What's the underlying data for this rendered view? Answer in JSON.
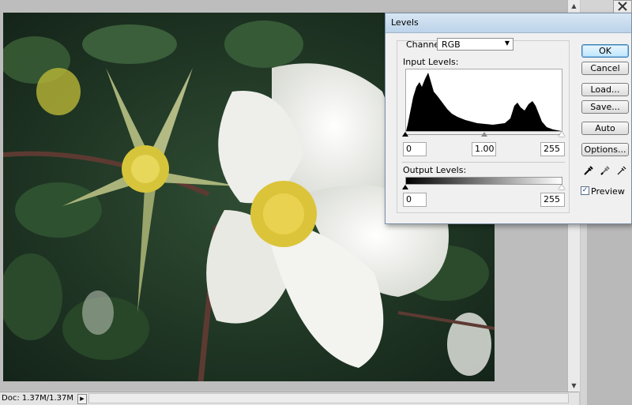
{
  "dialog": {
    "title": "Levels",
    "channel_label": "Channel:",
    "channel_value": "RGB",
    "input_levels_label": "Input Levels:",
    "input_black": "0",
    "input_gamma": "1.00",
    "input_white": "255",
    "output_levels_label": "Output Levels:",
    "output_black": "0",
    "output_white": "255",
    "buttons": {
      "ok": "OK",
      "cancel": "Cancel",
      "load": "Load...",
      "save": "Save...",
      "auto": "Auto",
      "options": "Options..."
    },
    "preview_label": "Preview",
    "preview_checked": true
  },
  "status": {
    "doc_info": "Doc: 1.37M/1.37M"
  },
  "icons": {
    "black_eyedropper": "black-eyedropper-icon",
    "gray_eyedropper": "gray-eyedropper-icon",
    "white_eyedropper": "white-eyedropper-icon",
    "scroll_up": "▲",
    "scroll_down": "▼",
    "play": "▶",
    "check": "✓",
    "tool": "tools-icon"
  },
  "colors": {
    "accent": "#3c7fb1",
    "title_bar": "#bcd3ea"
  }
}
